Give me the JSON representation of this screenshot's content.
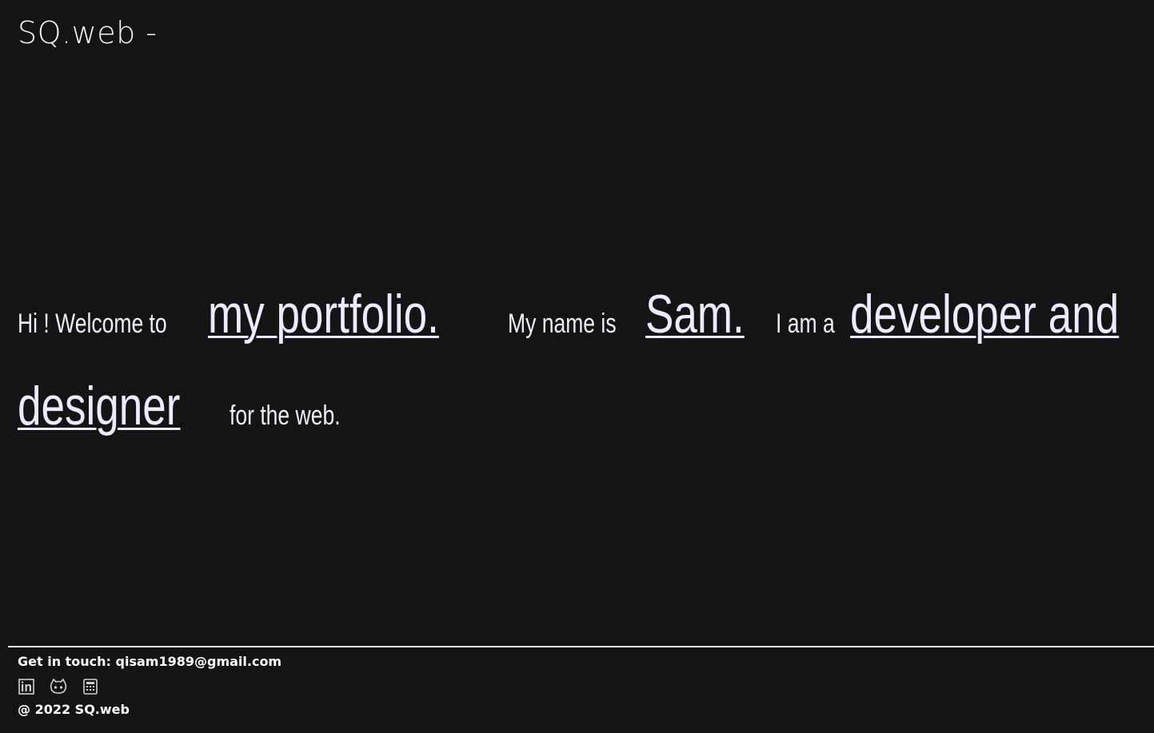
{
  "header": {
    "logo": "SQ.web -"
  },
  "hero": {
    "t1": "Hi ! Welcome to",
    "link1": "my portfolio.",
    "t2": "My name is",
    "link2": "Sam.",
    "t3": "I am a",
    "link3": "developer and",
    "link4": "designer",
    "t4": "for the web."
  },
  "footer": {
    "contact": "Get in touch: qisam1989@gmail.com",
    "icons": [
      "linkedin-icon",
      "github-icon",
      "calculator-icon"
    ],
    "copyright": "@ 2022 SQ.web"
  },
  "colors": {
    "background": "#141414",
    "text": "#ffffff",
    "accent": "#efeaff"
  }
}
